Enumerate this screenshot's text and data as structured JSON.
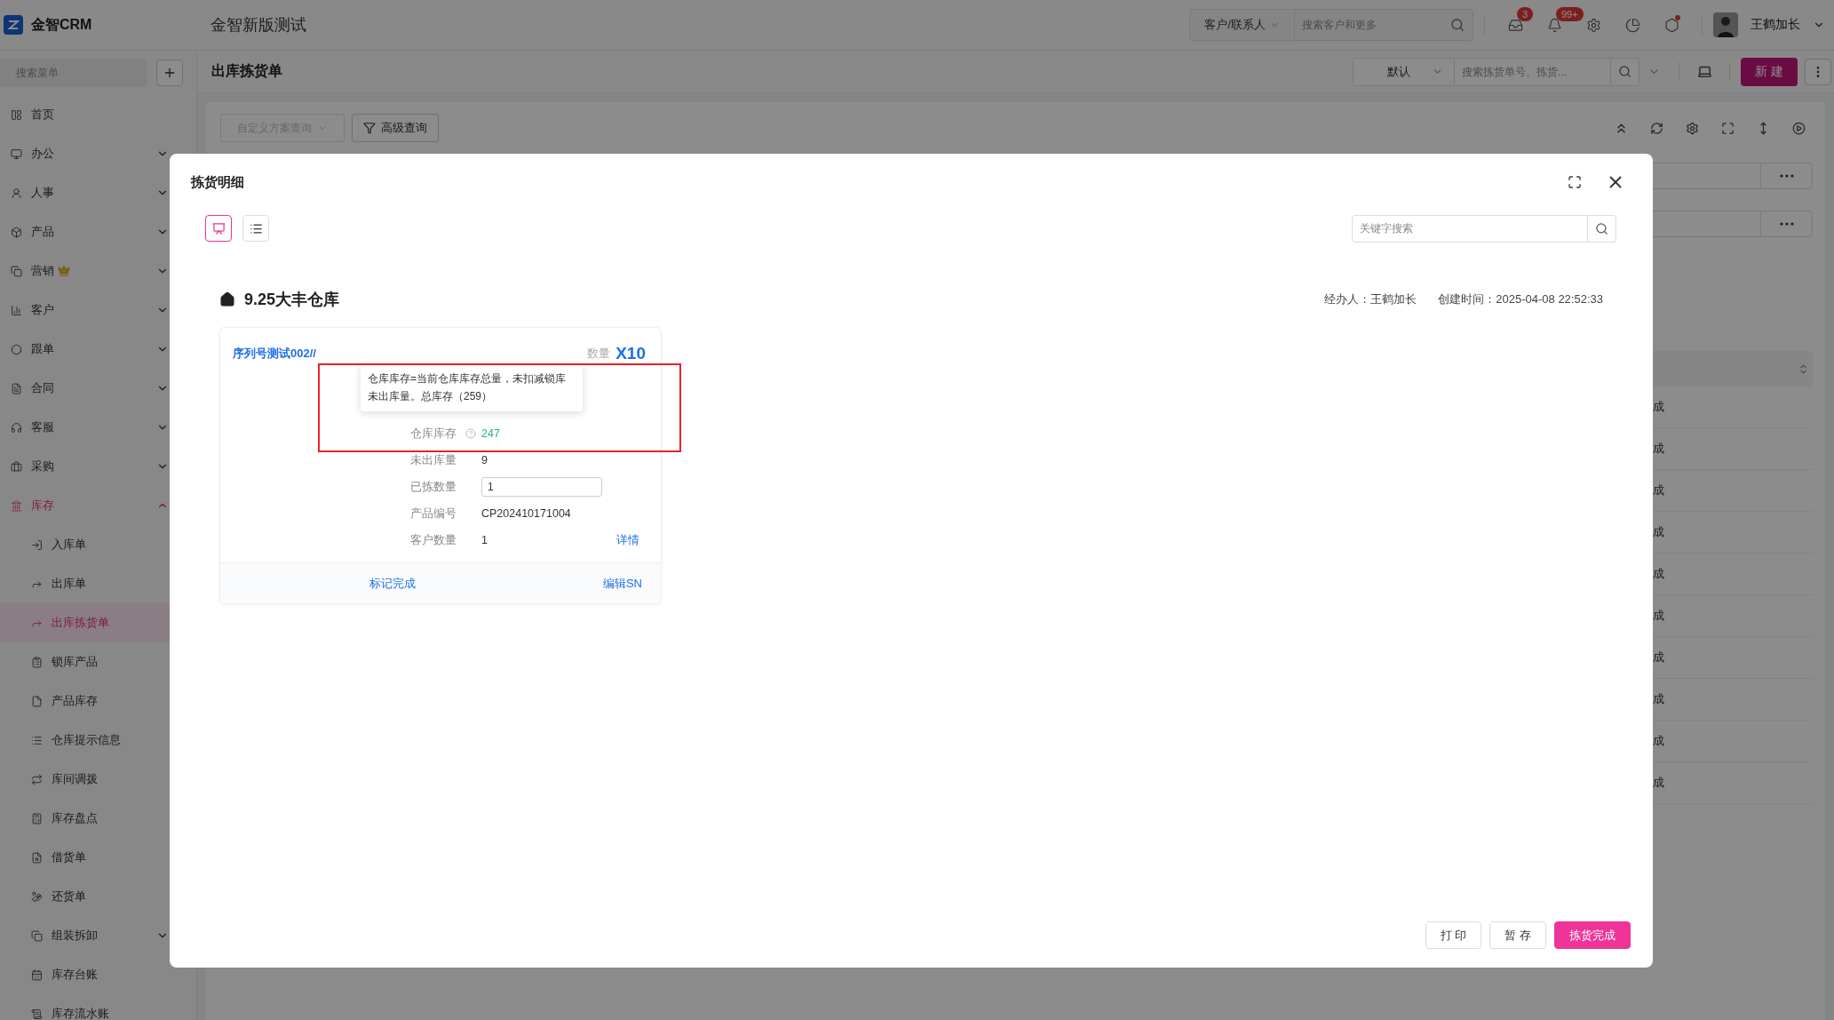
{
  "app": {
    "logo": "金智CRM",
    "title": "金智新版测试"
  },
  "topbar": {
    "scope": "客户/联系人",
    "search_placeholder": "搜索客户和更多",
    "tools": [
      {
        "kind": "inbox",
        "badge": "3"
      },
      {
        "kind": "bell",
        "badge": "99+"
      },
      {
        "kind": "settings",
        "alert": false
      },
      {
        "kind": "chart",
        "alert": false
      },
      {
        "kind": "hexagon",
        "alert": true
      }
    ],
    "user": "王鹤加长"
  },
  "sidebar": {
    "search_placeholder": "搜索菜单",
    "items": [
      {
        "label": "首页",
        "selected": false,
        "premium": false
      },
      {
        "label": "办公",
        "selected": false,
        "premium": false,
        "expanded": false
      },
      {
        "label": "人事",
        "selected": false,
        "premium": false,
        "expanded": false
      },
      {
        "label": "产品",
        "selected": false,
        "premium": false,
        "expanded": false
      },
      {
        "label": "营销",
        "selected": false,
        "premium": true,
        "expanded": false
      },
      {
        "label": "客户",
        "selected": false,
        "premium": false,
        "expanded": false
      },
      {
        "label": "跟单",
        "selected": false,
        "premium": false,
        "expanded": false
      },
      {
        "label": "合同",
        "selected": false,
        "premium": false,
        "expanded": false
      },
      {
        "label": "客服",
        "selected": false,
        "premium": false,
        "expanded": false
      },
      {
        "label": "采购",
        "selected": false,
        "premium": false,
        "expanded": false
      },
      {
        "label": "库存",
        "selected": true,
        "premium": false,
        "expanded": true,
        "children": [
          {
            "label": "入库单",
            "selected": false
          },
          {
            "label": "出库单",
            "selected": false
          },
          {
            "label": "出库拣货单",
            "selected": true
          },
          {
            "label": "锁库产品",
            "selected": false
          },
          {
            "label": "产品库存",
            "selected": false
          },
          {
            "label": "仓库提示信息",
            "selected": false
          },
          {
            "label": "库间调拨",
            "selected": false
          },
          {
            "label": "库存盘点",
            "selected": false
          },
          {
            "label": "借货单",
            "selected": false
          },
          {
            "label": "还货单",
            "selected": false
          },
          {
            "label": "组装拆卸",
            "selected": false,
            "expanded": false
          },
          {
            "label": "库存台账",
            "selected": false
          },
          {
            "label": "库存流水账",
            "selected": false
          }
        ]
      }
    ]
  },
  "page": {
    "title": "出库拣货单",
    "view": "默认",
    "search_placeholder": "搜索拣货单号、拣货...",
    "new_button": "新 建",
    "scheme_placeholder": "自定义方案查询",
    "advanced_query": "高级查询",
    "table": {
      "rows": [
        {
          "status": "成"
        },
        {
          "status": "成"
        },
        {
          "status": "成"
        },
        {
          "status": "成"
        },
        {
          "status": "成"
        },
        {
          "status": "成"
        },
        {
          "status": "成"
        },
        {
          "status": "成"
        },
        {
          "status": "成"
        },
        {
          "status": "成"
        }
      ]
    }
  },
  "modal": {
    "title": "拣货明细",
    "views": [
      {
        "selected": true
      },
      {
        "selected": false
      }
    ],
    "search_placeholder": "关键字搜索",
    "warehouse": "9.25大丰仓库",
    "handler_label": "经办人：",
    "handler": "王鹤加长",
    "created_label": "创建时间：",
    "created": "2025-04-08 22:52:33",
    "card": {
      "product": "序列号测试002//",
      "qty_label": "数量",
      "qty": "X10",
      "tooltip": "仓库库存=当前仓库库存总量，未扣减锁库未出库量。总库存（259）",
      "fields": [
        {
          "kind": "stock",
          "label": "仓库库存",
          "value": "247"
        },
        {
          "kind": "text",
          "label": "未出库量",
          "value": "9"
        },
        {
          "kind": "input",
          "label": "已拣数量",
          "value": "1"
        },
        {
          "kind": "text",
          "label": "产品编号",
          "value": "CP202410171004"
        },
        {
          "kind": "link",
          "label": "客户数量",
          "value": "1",
          "link": "详情"
        }
      ],
      "actions": [
        "标记完成",
        "编辑SN"
      ]
    },
    "buttons": [
      {
        "label": "打 印",
        "kind": "default"
      },
      {
        "label": "暂 存",
        "kind": "default"
      },
      {
        "label": "拣货完成",
        "kind": "primary"
      }
    ]
  }
}
